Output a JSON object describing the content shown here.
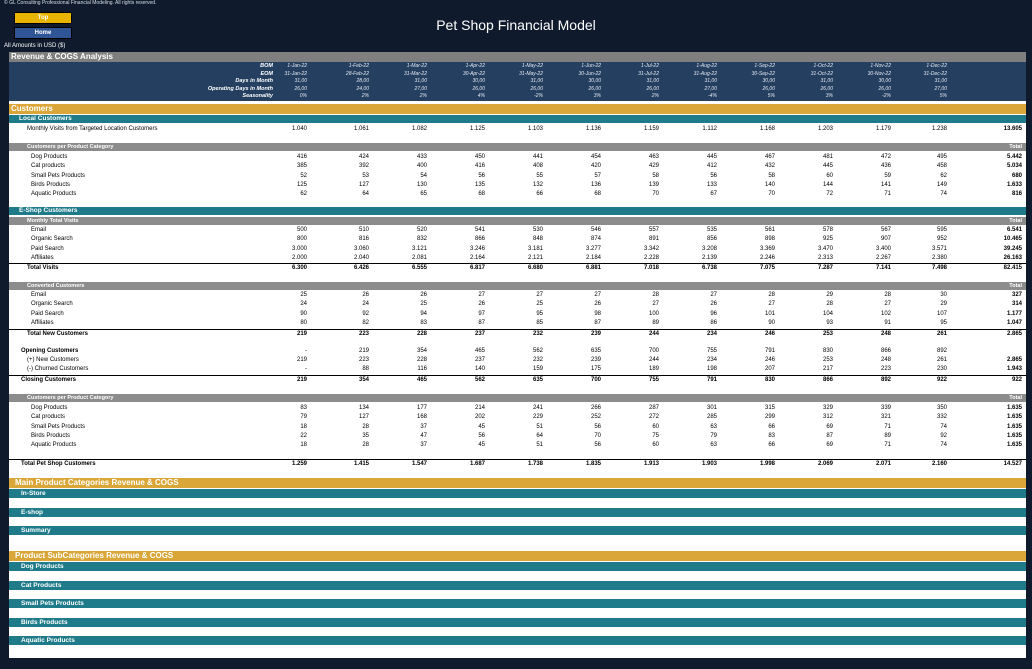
{
  "header": {
    "copyright": "© GL Consulting Professional Financial Modeling. All rights reserved.",
    "top_button": "Top",
    "home_button": "Home",
    "title": "Pet Shop Financial Model",
    "amounts_note": "All Amounts in  USD ($)"
  },
  "section_title": "Revenue & COGS Analysis",
  "timeline": {
    "labels": [
      "BOM",
      "EOM",
      "Days in Month",
      "Operating Days in Month",
      "Seasonality"
    ],
    "bom": [
      "1-Jan-22",
      "1-Feb-22",
      "1-Mar-22",
      "1-Apr-22",
      "1-May-22",
      "1-Jun-22",
      "1-Jul-22",
      "1-Aug-22",
      "1-Sep-22",
      "1-Oct-22",
      "1-Nov-22",
      "1-Dec-22"
    ],
    "eom": [
      "31-Jan-22",
      "28-Feb-22",
      "31-Mar-22",
      "30-Apr-22",
      "31-May-22",
      "30-Jun-22",
      "31-Jul-22",
      "31-Aug-22",
      "30-Sep-22",
      "31-Oct-22",
      "30-Nov-22",
      "31-Dec-22"
    ],
    "days": [
      "31,00",
      "28,00",
      "31,00",
      "30,00",
      "31,00",
      "30,00",
      "31,00",
      "31,00",
      "30,00",
      "31,00",
      "30,00",
      "31,00"
    ],
    "operating_days": [
      "26,00",
      "24,00",
      "27,00",
      "26,00",
      "26,00",
      "26,00",
      "26,00",
      "27,00",
      "26,00",
      "26,00",
      "26,00",
      "27,00"
    ],
    "seasonality": [
      "0%",
      "2%",
      "2%",
      "4%",
      "-2%",
      "3%",
      "2%",
      "-4%",
      "5%",
      "3%",
      "-2%",
      "5%"
    ]
  },
  "total_label": "Total",
  "customers": {
    "title": "Customers",
    "local": {
      "title": "Local Customers",
      "visits_label": "Monthly Visits from Targeted Location Customers",
      "visits": [
        "1.040",
        "1.061",
        "1.082",
        "1.125",
        "1.103",
        "1.136",
        "1.159",
        "1.112",
        "1.168",
        "1.203",
        "1.179",
        "1.238",
        "13.605"
      ],
      "per_cat_title": "Customers per Product Category",
      "per_cat": [
        {
          "label": "Dog Products",
          "values": [
            "416",
            "424",
            "433",
            "450",
            "441",
            "454",
            "463",
            "445",
            "467",
            "481",
            "472",
            "495",
            "5.442"
          ]
        },
        {
          "label": "Cat products",
          "values": [
            "385",
            "392",
            "400",
            "416",
            "408",
            "420",
            "429",
            "412",
            "432",
            "445",
            "436",
            "458",
            "5.034"
          ]
        },
        {
          "label": "Small Pets Products",
          "values": [
            "52",
            "53",
            "54",
            "56",
            "55",
            "57",
            "58",
            "56",
            "58",
            "60",
            "59",
            "62",
            "680"
          ]
        },
        {
          "label": "Birds Products",
          "values": [
            "125",
            "127",
            "130",
            "135",
            "132",
            "136",
            "139",
            "133",
            "140",
            "144",
            "141",
            "149",
            "1.633"
          ]
        },
        {
          "label": "Aquatic Products",
          "values": [
            "62",
            "64",
            "65",
            "68",
            "66",
            "68",
            "70",
            "67",
            "70",
            "72",
            "71",
            "74",
            "816"
          ]
        }
      ]
    },
    "eshop": {
      "title": "E-Shop Customers",
      "visits_title": "Monthly Total Visits",
      "visits": [
        {
          "label": "Email",
          "values": [
            "500",
            "510",
            "520",
            "541",
            "530",
            "546",
            "557",
            "535",
            "561",
            "578",
            "567",
            "595",
            "6.541"
          ]
        },
        {
          "label": "Organic Search",
          "values": [
            "800",
            "816",
            "832",
            "866",
            "848",
            "874",
            "891",
            "856",
            "898",
            "925",
            "907",
            "952",
            "10.465"
          ]
        },
        {
          "label": "Paid Search",
          "values": [
            "3.000",
            "3.060",
            "3.121",
            "3.246",
            "3.181",
            "3.277",
            "3.342",
            "3.208",
            "3.369",
            "3.470",
            "3.400",
            "3.571",
            "39.245"
          ]
        },
        {
          "label": "Affiliates",
          "values": [
            "2.000",
            "2.040",
            "2.081",
            "2.164",
            "2.121",
            "2.184",
            "2.228",
            "2.139",
            "2.246",
            "2.313",
            "2.267",
            "2.380",
            "26.163"
          ]
        }
      ],
      "total_visits": {
        "label": "Total Visits",
        "values": [
          "6.300",
          "6.426",
          "6.555",
          "6.817",
          "6.680",
          "6.881",
          "7.018",
          "6.738",
          "7.075",
          "7.287",
          "7.141",
          "7.498",
          "82.415"
        ]
      },
      "converted_title": "Converted Customers",
      "converted": [
        {
          "label": "Email",
          "values": [
            "25",
            "26",
            "26",
            "27",
            "27",
            "27",
            "28",
            "27",
            "28",
            "29",
            "28",
            "30",
            "327"
          ]
        },
        {
          "label": "Organic Search",
          "values": [
            "24",
            "24",
            "25",
            "26",
            "25",
            "26",
            "27",
            "26",
            "27",
            "28",
            "27",
            "29",
            "314"
          ]
        },
        {
          "label": "Paid Search",
          "values": [
            "90",
            "92",
            "94",
            "97",
            "95",
            "98",
            "100",
            "96",
            "101",
            "104",
            "102",
            "107",
            "1.177"
          ]
        },
        {
          "label": "Affiliates",
          "values": [
            "80",
            "82",
            "83",
            "87",
            "85",
            "87",
            "89",
            "86",
            "90",
            "93",
            "91",
            "95",
            "1.047"
          ]
        }
      ],
      "total_new": {
        "label": "Total New Customers",
        "values": [
          "219",
          "223",
          "228",
          "237",
          "232",
          "239",
          "244",
          "234",
          "246",
          "253",
          "248",
          "261",
          "2.865"
        ]
      },
      "opening": {
        "label": "Opening Customers",
        "values": [
          "-",
          "219",
          "354",
          "465",
          "562",
          "635",
          "700",
          "755",
          "791",
          "830",
          "866",
          "892",
          ""
        ]
      },
      "new": {
        "label": "(+) New Customers",
        "values": [
          "219",
          "223",
          "228",
          "237",
          "232",
          "239",
          "244",
          "234",
          "246",
          "253",
          "248",
          "261",
          "2.865"
        ]
      },
      "churned": {
        "label": "(-) Churned Customers",
        "values": [
          "-",
          "88",
          "116",
          "140",
          "159",
          "175",
          "189",
          "198",
          "207",
          "217",
          "223",
          "230",
          "1.943"
        ]
      },
      "closing": {
        "label": "Closing Customers",
        "values": [
          "219",
          "354",
          "465",
          "562",
          "635",
          "700",
          "755",
          "791",
          "830",
          "866",
          "892",
          "922",
          "922"
        ]
      },
      "per_cat_title": "Customers per Product Category",
      "per_cat": [
        {
          "label": "Dog Products",
          "values": [
            "83",
            "134",
            "177",
            "214",
            "241",
            "266",
            "287",
            "301",
            "315",
            "329",
            "339",
            "350",
            "1.635"
          ]
        },
        {
          "label": "Cat products",
          "values": [
            "79",
            "127",
            "168",
            "202",
            "229",
            "252",
            "272",
            "285",
            "299",
            "312",
            "321",
            "332",
            "1.635"
          ]
        },
        {
          "label": "Small Pets Products",
          "values": [
            "18",
            "28",
            "37",
            "45",
            "51",
            "56",
            "60",
            "63",
            "66",
            "69",
            "71",
            "74",
            "1.635"
          ]
        },
        {
          "label": "Birds Products",
          "values": [
            "22",
            "35",
            "47",
            "56",
            "64",
            "70",
            "75",
            "79",
            "83",
            "87",
            "89",
            "92",
            "1.635"
          ]
        },
        {
          "label": "Aquatic Products",
          "values": [
            "18",
            "28",
            "37",
            "45",
            "51",
            "56",
            "60",
            "63",
            "66",
            "69",
            "71",
            "74",
            "1.635"
          ]
        }
      ]
    },
    "total_pet_shop": {
      "label": "Total Pet Shop Customers",
      "values": [
        "1.259",
        "1.415",
        "1.547",
        "1.687",
        "1.738",
        "1.835",
        "1.913",
        "1.903",
        "1.998",
        "2.069",
        "2.071",
        "2.160",
        "14.527"
      ]
    }
  },
  "main_categories": {
    "title": "Main Product Categories Revenue & COGS",
    "items": [
      "In-Store",
      "E-shop",
      "Summary"
    ]
  },
  "sub_categories": {
    "title": "Product SubCategories Revenue & COGS",
    "items": [
      "Dog Products",
      "Cat Products",
      "Small Pets Products",
      "Birds Products",
      "Aquatic Products"
    ]
  }
}
